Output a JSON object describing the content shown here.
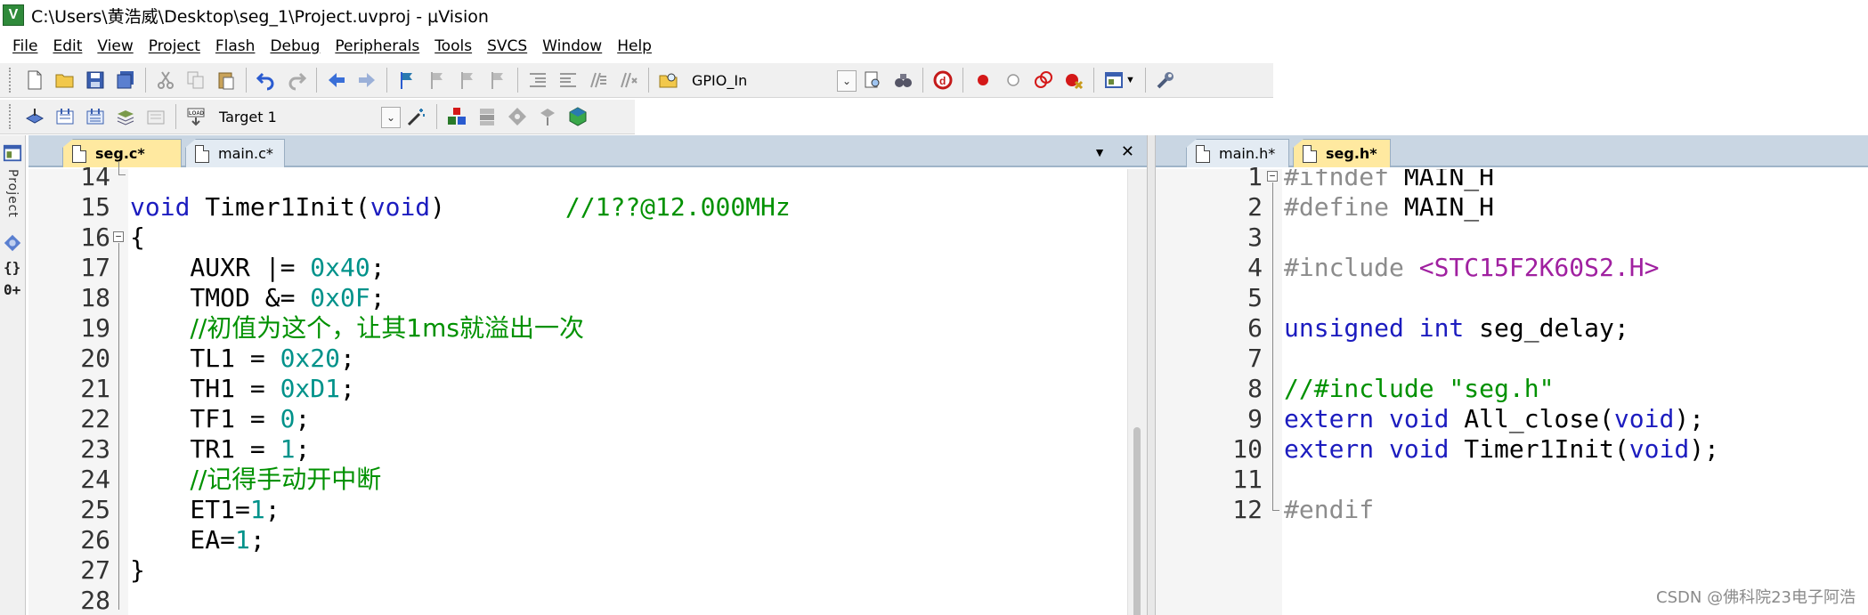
{
  "window": {
    "title": "C:\\Users\\黄浩威\\Desktop\\seg_1\\Project.uvproj - µVision",
    "logo_letter": "V"
  },
  "menu": [
    "File",
    "Edit",
    "View",
    "Project",
    "Flash",
    "Debug",
    "Peripherals",
    "Tools",
    "SVCS",
    "Window",
    "Help"
  ],
  "toolbar1": {
    "find_combo_value": "GPIO_In"
  },
  "toolbar2": {
    "target_combo_value": "Target 1",
    "load_label": "LOAD"
  },
  "left_strip": {
    "label": "Project",
    "functions_glyph": "{}",
    "templates_glyph": "0+"
  },
  "left_editor": {
    "tabs": [
      {
        "label": "seg.c*",
        "active": true
      },
      {
        "label": "main.c*",
        "active": false
      }
    ],
    "dropdown_glyph": "▼",
    "close_glyph": "✕",
    "line_numbers": [
      "14",
      "15",
      "16",
      "17",
      "18",
      "19",
      "20",
      "21",
      "22",
      "23",
      "24",
      "25",
      "26",
      "27",
      "28"
    ]
  },
  "right_editor": {
    "tabs": [
      {
        "label": "main.h*",
        "active": false
      },
      {
        "label": "seg.h*",
        "active": true
      }
    ],
    "line_numbers": [
      "1",
      "2",
      "3",
      "4",
      "5",
      "6",
      "7",
      "8",
      "9",
      "10",
      "11",
      "12"
    ]
  },
  "seg_c_code": {
    "l15": {
      "kw1": "void",
      "name": " Timer1Init(",
      "kw2": "void",
      "close": ")",
      "pad": "        ",
      "comment": "//1??@12.000MHz"
    },
    "l16": "{",
    "l17": {
      "pre": "    AUXR |= ",
      "num": "0x40",
      "post": ";"
    },
    "l18": {
      "pre": "    TMOD &= ",
      "num": "0x0F",
      "post": ";"
    },
    "l19": {
      "pre": "    ",
      "comment": "//初值为这个，让其1ms就溢出一次"
    },
    "l20": {
      "pre": "    TL1 = ",
      "num": "0x20",
      "post": ";"
    },
    "l21": {
      "pre": "    TH1 = ",
      "num": "0xD1",
      "post": ";"
    },
    "l22": {
      "pre": "    TF1 = ",
      "num": "0",
      "post": ";"
    },
    "l23": {
      "pre": "    TR1 = ",
      "num": "1",
      "post": ";"
    },
    "l24": {
      "pre": "    ",
      "comment": "//记得手动开中断"
    },
    "l25": {
      "pre": "    ET1=",
      "num": "1",
      "post": ";"
    },
    "l26": {
      "pre": "    EA=",
      "num": "1",
      "post": ";"
    },
    "l27": "}"
  },
  "seg_h_code": {
    "l1": {
      "pp": "#ifndef",
      "rest": " MAIN_H"
    },
    "l2": {
      "pp": "#define",
      "rest": " MAIN_H"
    },
    "l4": {
      "pp": "#include",
      "sp": " ",
      "str": "<STC15F2K60S2.H>"
    },
    "l6": {
      "kw1": "unsigned",
      "sp": " ",
      "kw2": "int",
      "rest": " seg_delay;"
    },
    "l8": {
      "comment": "//#include \"seg.h\""
    },
    "l9": {
      "kw1": "extern",
      "sp": " ",
      "kw2": "void",
      "name": " All_close(",
      "kw3": "void",
      "close": ");"
    },
    "l10": {
      "kw1": "extern",
      "sp": " ",
      "kw2": "void",
      "name": " Timer1Init(",
      "kw3": "void",
      "close": ");"
    },
    "l12": {
      "pp": "#endif"
    }
  },
  "watermark": "CSDN @佛科院23电子阿浩",
  "colors": {
    "keyword": "#1c1cbf",
    "number": "#00928a",
    "comment": "#009100",
    "preprocessor": "#8c8c8c",
    "string": "#a020a0",
    "active_tab": "#ffe9a0",
    "tab_strip": "#c9d6e3"
  }
}
